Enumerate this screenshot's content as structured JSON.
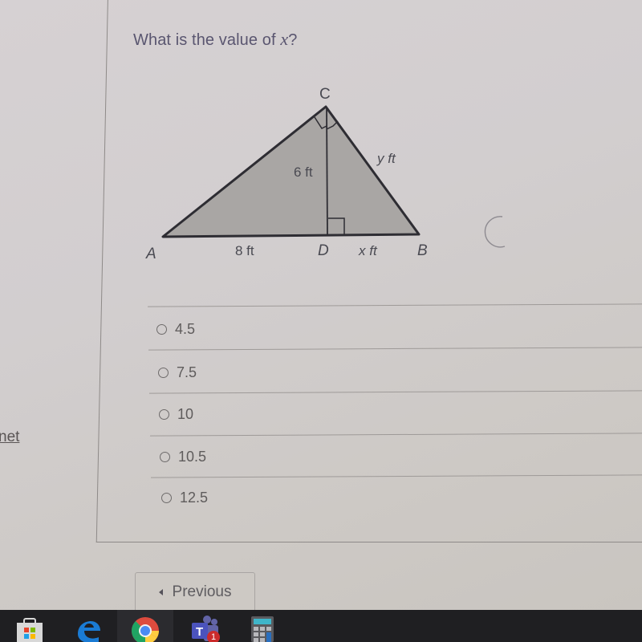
{
  "left_nav": {
    "link_fragment": "net"
  },
  "question": {
    "prefix": "What is the value of ",
    "variable": "x",
    "suffix": "?"
  },
  "figure": {
    "vertex_labels": {
      "A": "A",
      "B": "B",
      "C": "C",
      "D": "D"
    },
    "segment_labels": {
      "AD": "8 ft",
      "CD": "6 ft",
      "DB": "x ft",
      "CB": "y ft"
    },
    "right_angles": [
      "ACB",
      "CDB"
    ],
    "fill_color": "#a9a6a4",
    "stroke_color": "#2e2d33"
  },
  "choices": [
    {
      "label": "4.5",
      "selected": false
    },
    {
      "label": "7.5",
      "selected": false
    },
    {
      "label": "10",
      "selected": false
    },
    {
      "label": "10.5",
      "selected": false
    },
    {
      "label": "12.5",
      "selected": false
    }
  ],
  "navigation": {
    "previous_label": "Previous"
  },
  "taskbar": {
    "items": [
      {
        "name": "microsoft-store"
      },
      {
        "name": "edge"
      },
      {
        "name": "chrome",
        "active": true
      },
      {
        "name": "teams",
        "badge": "1"
      },
      {
        "name": "calculator"
      }
    ]
  }
}
